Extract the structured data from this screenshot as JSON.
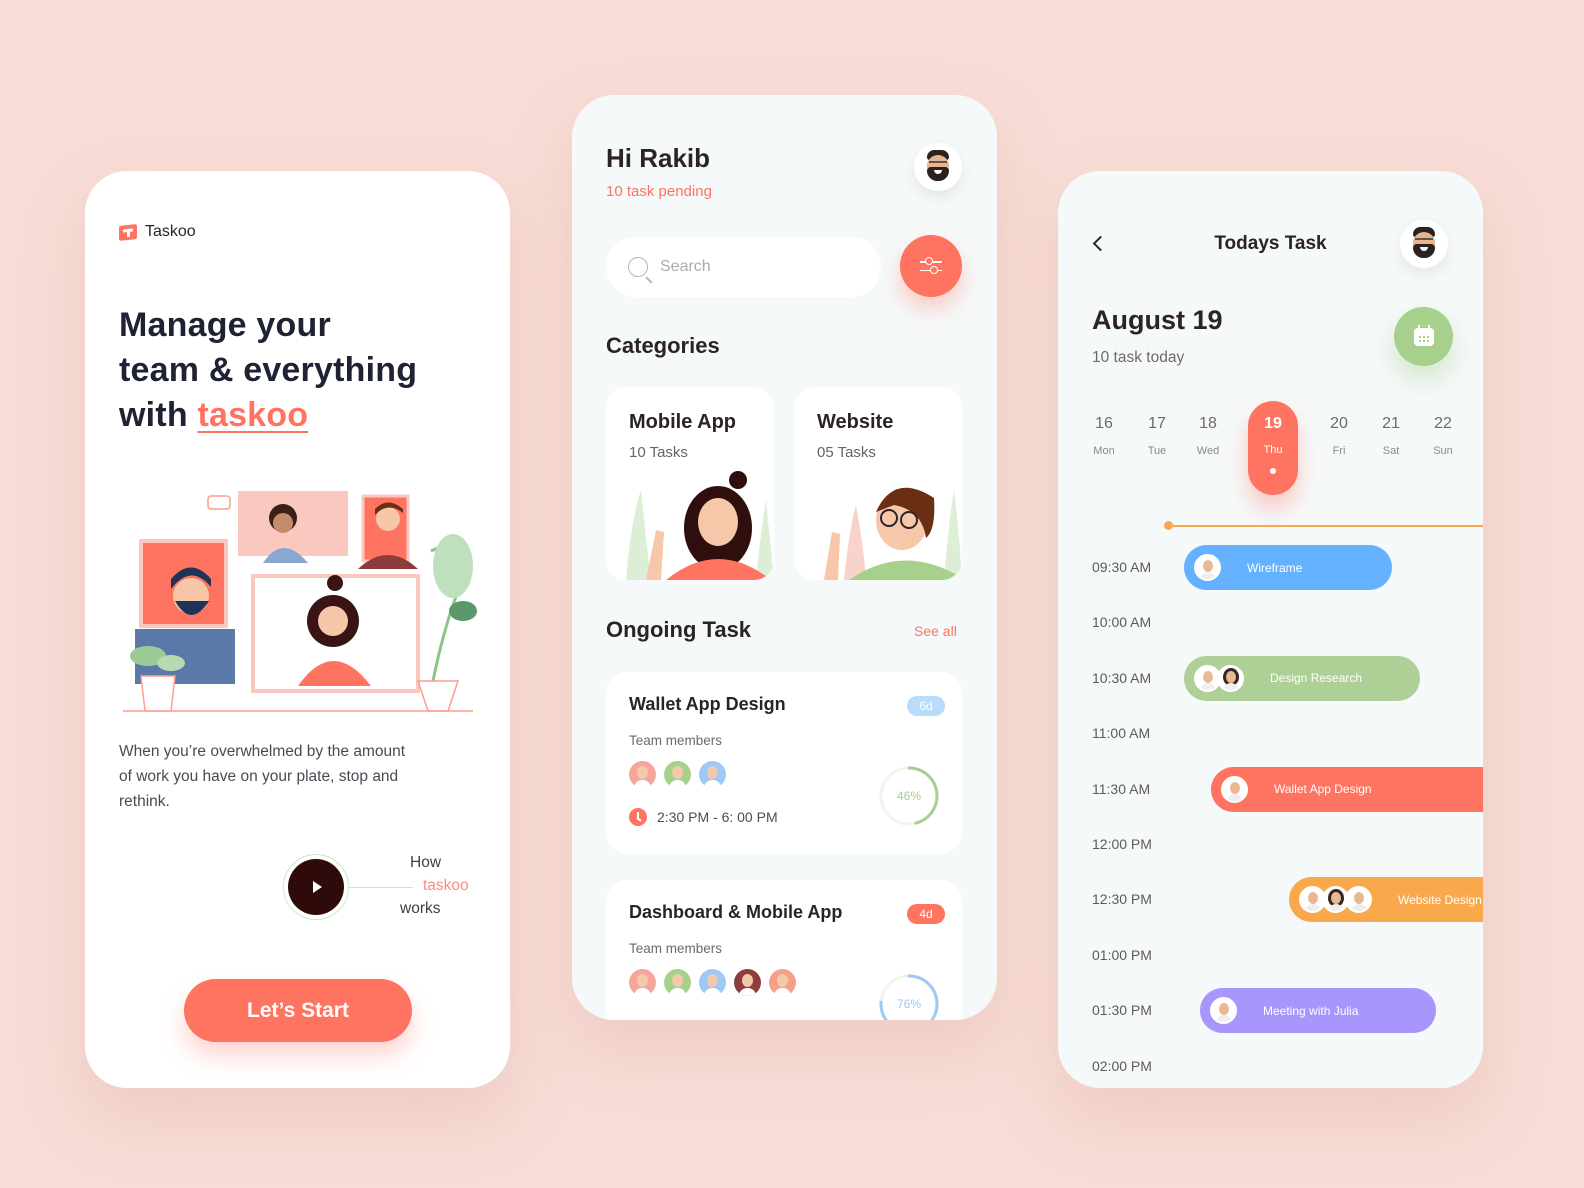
{
  "colors": {
    "background": "#f7ddd6",
    "accent": "#ff7361",
    "green": "#a8d08d",
    "blue": "#64b2ff",
    "orange": "#f9a94b",
    "purple": "#a896fd",
    "dark_text": "#2b2326"
  },
  "onboarding": {
    "brand_icon": "taskoo-logo-icon",
    "brand_name": "Taskoo",
    "headline_line1": "Manage your",
    "headline_line2": "team & everything",
    "headline_line3_prefix": "with ",
    "headline_accent": "taskoo",
    "illustration": "video-call-team-illustration",
    "description": "When you’re overwhelmed by the amount of work you have on your plate, stop and rethink.",
    "how_it_works": {
      "icon": "play-icon",
      "line1": "How",
      "line2": "taskoo",
      "line3": "works"
    },
    "start_button": "Let’s Start"
  },
  "home": {
    "greeting": "Hi Rakib",
    "pending": "10 task pending",
    "avatar": "memoji-avatar",
    "search": {
      "placeholder": "Search",
      "value": "",
      "icon": "search-icon"
    },
    "filter_icon": "sliders-icon",
    "categories_title": "Categories",
    "categories": [
      {
        "name": "Mobile App",
        "count": "10 Tasks",
        "illustration": "woman-waving-illustration"
      },
      {
        "name": "Website",
        "count": "05 Tasks",
        "illustration": "man-glasses-waving-illustration"
      }
    ],
    "ongoing_title": "Ongoing Task",
    "see_all": "See all",
    "tasks": [
      {
        "name": "Wallet App Design",
        "badge": "6d",
        "badge_color": "#b9dcfb",
        "members_label": "Team members",
        "members": [
          "#f6a59b",
          "#a8d08d",
          "#9cc9f5"
        ],
        "time": "2:30 PM - 6: 00 PM",
        "progress": 46,
        "progress_label": "46%",
        "progress_color": "#a8d08d"
      },
      {
        "name": "Dashboard & Mobile App",
        "badge": "4d",
        "badge_color": "#ff7361",
        "members_label": "Team members",
        "members": [
          "#f6a59b",
          "#a8d08d",
          "#9cc9f5",
          "#8f3d3d",
          "#f4a08a"
        ],
        "progress": 76,
        "progress_label": "76%",
        "progress_color": "#9cc9f5"
      }
    ]
  },
  "today": {
    "title": "Todays Task",
    "back_icon": "chevron-left-icon",
    "avatar": "memoji-avatar",
    "date": "August 19",
    "subtitle": "10 task today",
    "calendar_icon": "calendar-icon",
    "week": [
      {
        "num": "16",
        "name": "Mon"
      },
      {
        "num": "17",
        "name": "Tue"
      },
      {
        "num": "18",
        "name": "Wed"
      },
      {
        "num": "19",
        "name": "Thu",
        "active": true
      },
      {
        "num": "20",
        "name": "Fri"
      },
      {
        "num": "21",
        "name": "Sat"
      },
      {
        "num": "22",
        "name": "Sun"
      }
    ],
    "times": [
      "09:30 AM",
      "10:00 AM",
      "10:30 AM",
      "11:00 AM",
      "11:30 AM",
      "12:00 PM",
      "12:30 PM",
      "01:00 PM",
      "01:30 PM",
      "02:00 PM"
    ],
    "events": [
      {
        "label": "Wireframe",
        "time": "09:30 AM",
        "color": "#64b2ff",
        "avatars": 1
      },
      {
        "label": "Design Research",
        "time": "10:30 AM",
        "color": "#aed097",
        "avatars": 2
      },
      {
        "label": "Wallet App Design",
        "time": "11:30 AM",
        "color": "#ff7361",
        "avatars": 1
      },
      {
        "label": "Website Design",
        "time": "12:30 PM",
        "color": "#f9a94b",
        "avatars": 3
      },
      {
        "label": "Meeting with Julia",
        "time": "01:30 PM",
        "color": "#a896fd",
        "avatars": 1
      }
    ]
  }
}
